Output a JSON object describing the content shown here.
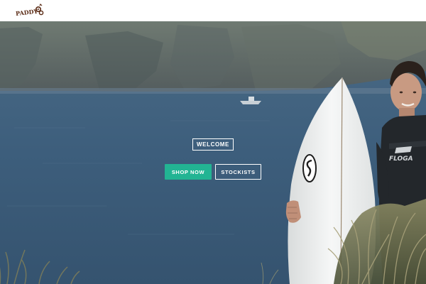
{
  "brand": {
    "logo_text": "PADDY'S"
  },
  "hero": {
    "welcome_label": "WELCOME",
    "shop_now_label": "SHOP NOW",
    "stockists_label": "STOCKISTS",
    "wetsuit_logo_text": "FLOGA"
  },
  "colors": {
    "accent": "#22b493",
    "sea": "#3a5a78",
    "cliff": "#5e6a64",
    "logo": "#5a2a14"
  }
}
